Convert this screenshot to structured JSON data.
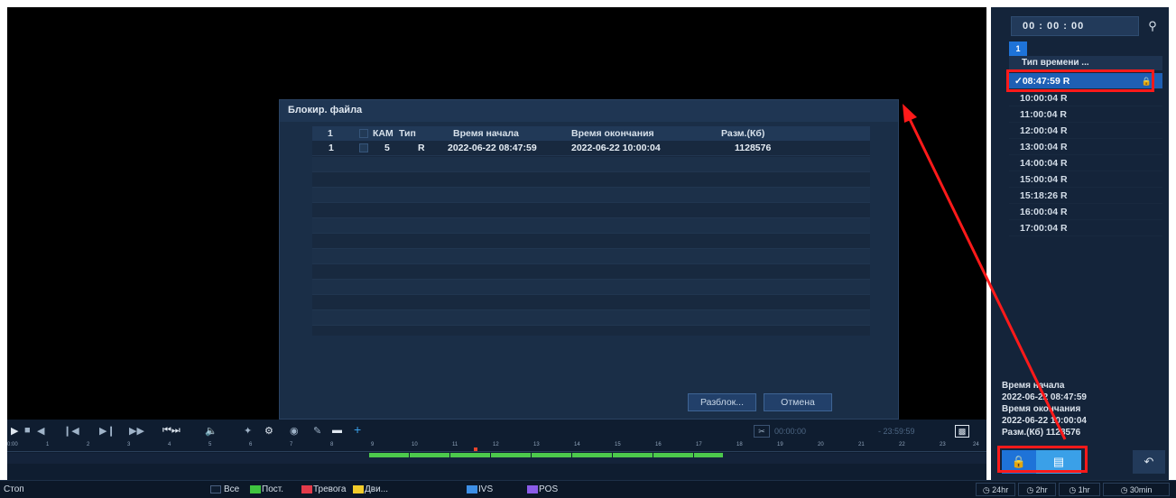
{
  "dialog": {
    "title": "Блокир. файла",
    "columns": [
      "1",
      "КАМ",
      "Тип",
      "Время начала",
      "Время окончания",
      "Разм.(Кб)"
    ],
    "rows": [
      {
        "num": "1",
        "cam": "5",
        "type": "R",
        "start": "2022-06-22 08:47:59",
        "end": "2022-06-22 10:00:04",
        "size": "1128576"
      }
    ],
    "unlock_label": "Разблок...",
    "cancel_label": "Отмена"
  },
  "right_panel": {
    "time_value": "00 : 00 : 00",
    "channel_tab": "1",
    "type_header": "Тип времени ...",
    "files": [
      "08:47:59 R",
      "10:00:04 R",
      "11:00:04 R",
      "12:00:04 R",
      "13:00:04 R",
      "14:00:04 R",
      "15:00:04 R",
      "15:18:26 R",
      "16:00:04 R",
      "17:00:04 R"
    ],
    "selected_check": "✓",
    "info": {
      "start_label": "Время начала",
      "start_value": "2022-06-22 08:47:59",
      "end_label": "Время окончания",
      "end_value": "2022-06-22 10:00:04",
      "size_label": "Разм.(Кб) 1128576"
    }
  },
  "timeline": {
    "clip_start": "00:00:00",
    "clip_end": "- 23:59:59",
    "hours": [
      "0:00",
      "1",
      "2",
      "3",
      "4",
      "5",
      "6",
      "7",
      "8",
      "9",
      "10",
      "11",
      "12",
      "13",
      "14",
      "15",
      "16",
      "17",
      "18",
      "19",
      "20",
      "21",
      "22",
      "23",
      "24"
    ]
  },
  "status": {
    "state": "Стоп",
    "legend": [
      {
        "label": "Все",
        "color": "#0f1d30"
      },
      {
        "label": "Пост.",
        "color": "#3fc43f"
      },
      {
        "label": "Тревога",
        "color": "#e23b4a"
      },
      {
        "label": "Дви...",
        "color": "#f3cc2a"
      },
      {
        "label": "IVS",
        "color": "#3d8fe6"
      },
      {
        "label": "POS",
        "color": "#8a5ce8"
      }
    ],
    "zoom": [
      "24hr",
      "2hr",
      "1hr",
      "30min"
    ]
  },
  "colors": {
    "accent": "#1e73d8",
    "annotation": "#ff1a1a",
    "record": "#4cc94c"
  }
}
